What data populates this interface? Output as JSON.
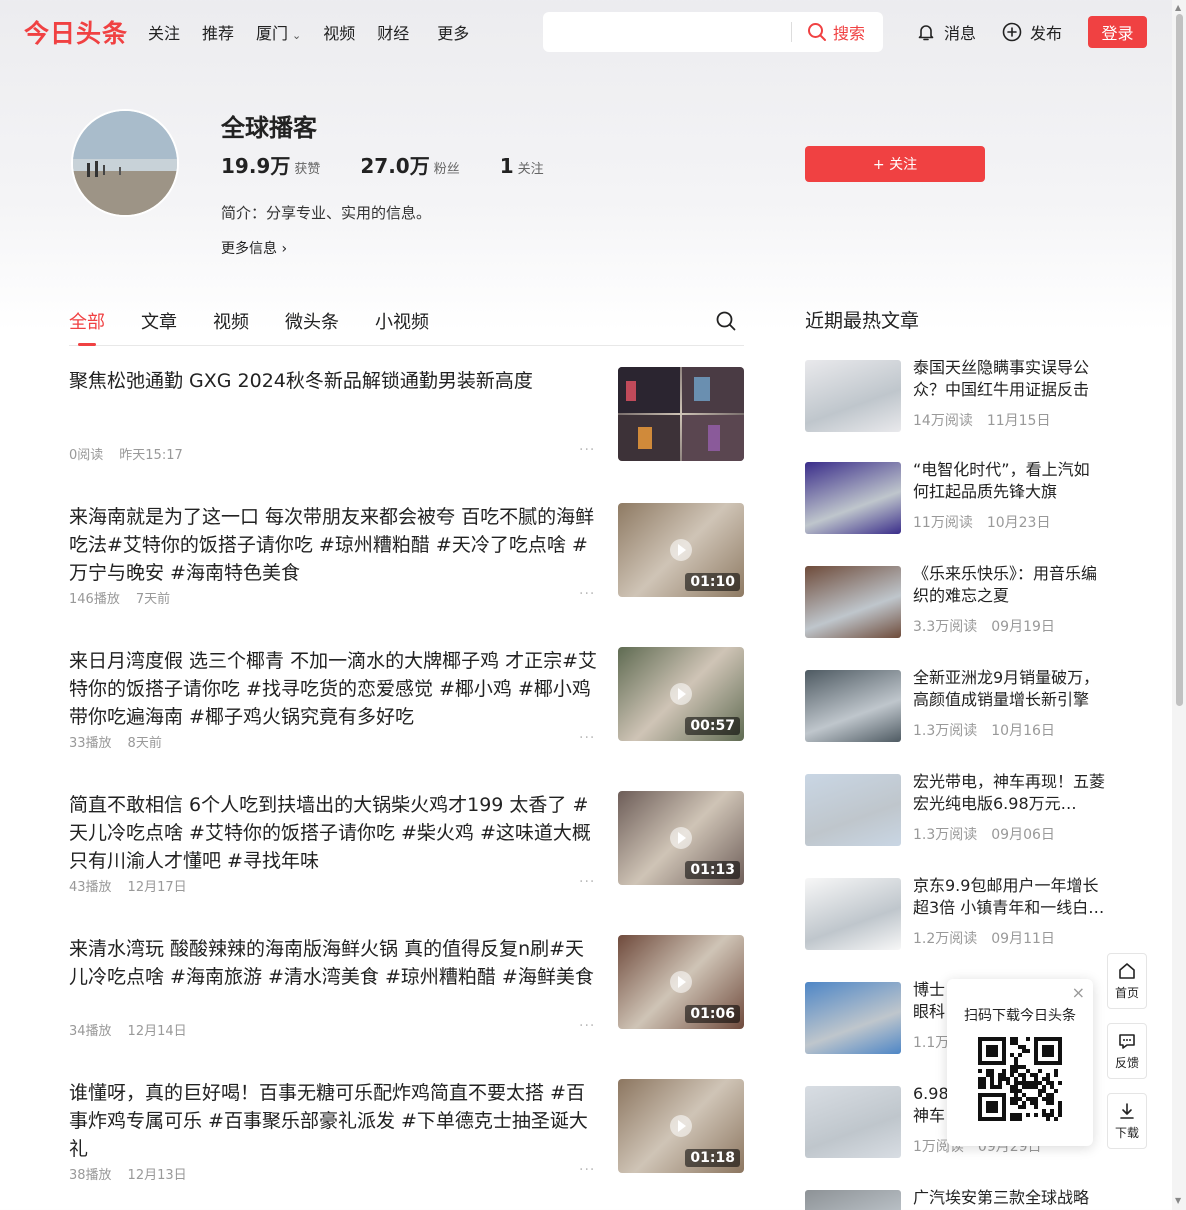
{
  "brand": {
    "logo_text": "今日头条",
    "accent": "#f04142"
  },
  "nav": {
    "items": [
      "关注",
      "推荐",
      "厦门",
      "视频",
      "财经",
      "更多"
    ],
    "search_placeholder": "",
    "search_label": "搜索",
    "messages_label": "消息",
    "publish_label": "发布",
    "login_label": "登录"
  },
  "profile": {
    "name": "全球播客",
    "likes_num": "19.9万",
    "likes_label": "获赞",
    "fans_num": "27.0万",
    "fans_label": "粉丝",
    "following_num": "1",
    "following_label": "关注",
    "bio": "简介：分享专业、实用的信息。",
    "more_info": "更多信息",
    "follow_label": "+ 关注"
  },
  "tabs": [
    "全部",
    "文章",
    "视频",
    "微头条",
    "小视频"
  ],
  "feed": [
    {
      "title": "聚焦松弛通勤 GXG 2024秋冬新品解锁通勤男装新高度",
      "stat": "0阅读",
      "time": "昨天15:17",
      "duration": "",
      "thumb_color": "#3a2f36"
    },
    {
      "title": "来海南就是为了这一口 每次带朋友来都会被夸 百吃不腻的海鲜吃法#艾特你的饭搭子请你吃 #琼州糟粕醋 #天冷了吃点啥 #万宁与晚安 #海南特色美食",
      "stat": "146播放",
      "time": "7天前",
      "duration": "01:10",
      "thumb_color": "#8e7a63"
    },
    {
      "title": "来日月湾度假 选三个椰青 不加一滴水的大牌椰子鸡 才正宗#艾特你的饭搭子请你吃 #找寻吃货的恋爱感觉 #椰小鸡 #椰小鸡带你吃遍海南 #椰子鸡火锅究竟有多好吃",
      "stat": "33播放",
      "time": "8天前",
      "duration": "00:57",
      "thumb_color": "#5f6b52"
    },
    {
      "title": "简直不敢相信 6个人吃到扶墙出的大锅柴火鸡才199 太香了 #天儿冷吃点啥 #艾特你的饭搭子请你吃 #柴火鸡 #这味道大概只有川渝人才懂吧 #寻找年味",
      "stat": "43播放",
      "time": "12月17日",
      "duration": "01:13",
      "thumb_color": "#6d5d58"
    },
    {
      "title": "来清水湾玩 酸酸辣辣的海南版海鲜火锅 真的值得反复n刷#天儿冷吃点啥 #海南旅游 #清水湾美食 #琼州糟粕醋 #海鲜美食",
      "stat": "34播放",
      "time": "12月14日",
      "duration": "01:06",
      "thumb_color": "#6f4a3c"
    },
    {
      "title": "谁懂呀，真的巨好喝！百事无糖可乐配炸鸡简直不要太搭 #百事炸鸡专属可乐 #百事聚乐部豪礼派发 #下单德克士抽圣诞大礼",
      "stat": "38播放",
      "time": "12月13日",
      "duration": "01:18",
      "thumb_color": "#8c7660"
    }
  ],
  "sidebar": {
    "title": "近期最热文章",
    "items": [
      {
        "title": "泰国天丝隐瞒事实误导公众？中国红牛用证据反击",
        "reads": "14万阅读",
        "date": "11月15日",
        "thumb_color": "#e9e9ec"
      },
      {
        "title": "“电智化时代”，看上汽如何扛起品质先锋大旗",
        "reads": "11万阅读",
        "date": "10月23日",
        "thumb_color": "#3a2d8a"
      },
      {
        "title": "《乐来乐快乐》：用音乐编织的难忘之夏",
        "reads": "3.3万阅读",
        "date": "09月19日",
        "thumb_color": "#6e4b3a"
      },
      {
        "title": "全新亚洲龙9月销量破万，高颜值成销量增长新引擎",
        "reads": "1.3万阅读",
        "date": "10月16日",
        "thumb_color": "#4e5a62"
      },
      {
        "title": "宏光带电，神车再现！五菱宏光纯电版6.98万元…",
        "reads": "1.3万阅读",
        "date": "09月06日",
        "thumb_color": "#c9d6e4"
      },
      {
        "title": "京东9.9包邮用户一年增长超3倍 小镇青年和一线白…",
        "reads": "1.2万阅读",
        "date": "09月11日",
        "thumb_color": "#f7f7f7"
      },
      {
        "title": "博士",
        "title2": "眼科",
        "reads": "1.1万",
        "date": "",
        "thumb_color": "#4e86c6"
      },
      {
        "title": "6.98",
        "title2": "神车",
        "reads": "1万阅读",
        "date": "09月29日",
        "thumb_color": "#d8dde3"
      },
      {
        "title": "广汽埃安第三款全球战略",
        "reads": "",
        "date": "",
        "thumb_color": "#8d9296"
      }
    ]
  },
  "qr_popup": {
    "text": "扫码下载今日头条"
  },
  "float_buttons": {
    "home": "首页",
    "feedback": "反馈",
    "download": "下载"
  }
}
